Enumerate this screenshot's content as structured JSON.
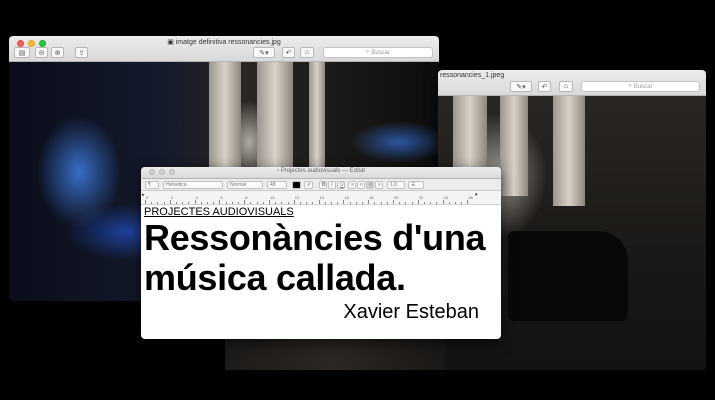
{
  "preview_window_1": {
    "title": "imatge definitiva ressonancies.jpg",
    "search_placeholder": "Buscar"
  },
  "preview_window_2": {
    "title": "ressonancies_1.jpeg",
    "search_placeholder": "Buscar"
  },
  "editor_window": {
    "title": "Projectes audiovisuals — Editat",
    "format_bar": {
      "paragraph_style": "¶",
      "font_family": "Helvetica",
      "font_style": "Normal",
      "font_size": "48",
      "line_spacing": "1,0",
      "list_style": "☰"
    },
    "ruler_numbers": [
      "0",
      "2",
      "4",
      "6",
      "8",
      "10",
      "12",
      "14",
      "16",
      "18",
      "20",
      "22",
      "24",
      "26"
    ],
    "document": {
      "heading": "PROJECTES AUDIOVISUALS",
      "title_line_1": "Ressonàncies d'una",
      "title_line_2": "música callada.",
      "author": "Xavier Esteban"
    }
  },
  "colors": {
    "glow_blue": "#3a78ff",
    "close_red": "#fc5f57",
    "minimize_yellow": "#fdbc2e",
    "zoom_green": "#28c840"
  }
}
